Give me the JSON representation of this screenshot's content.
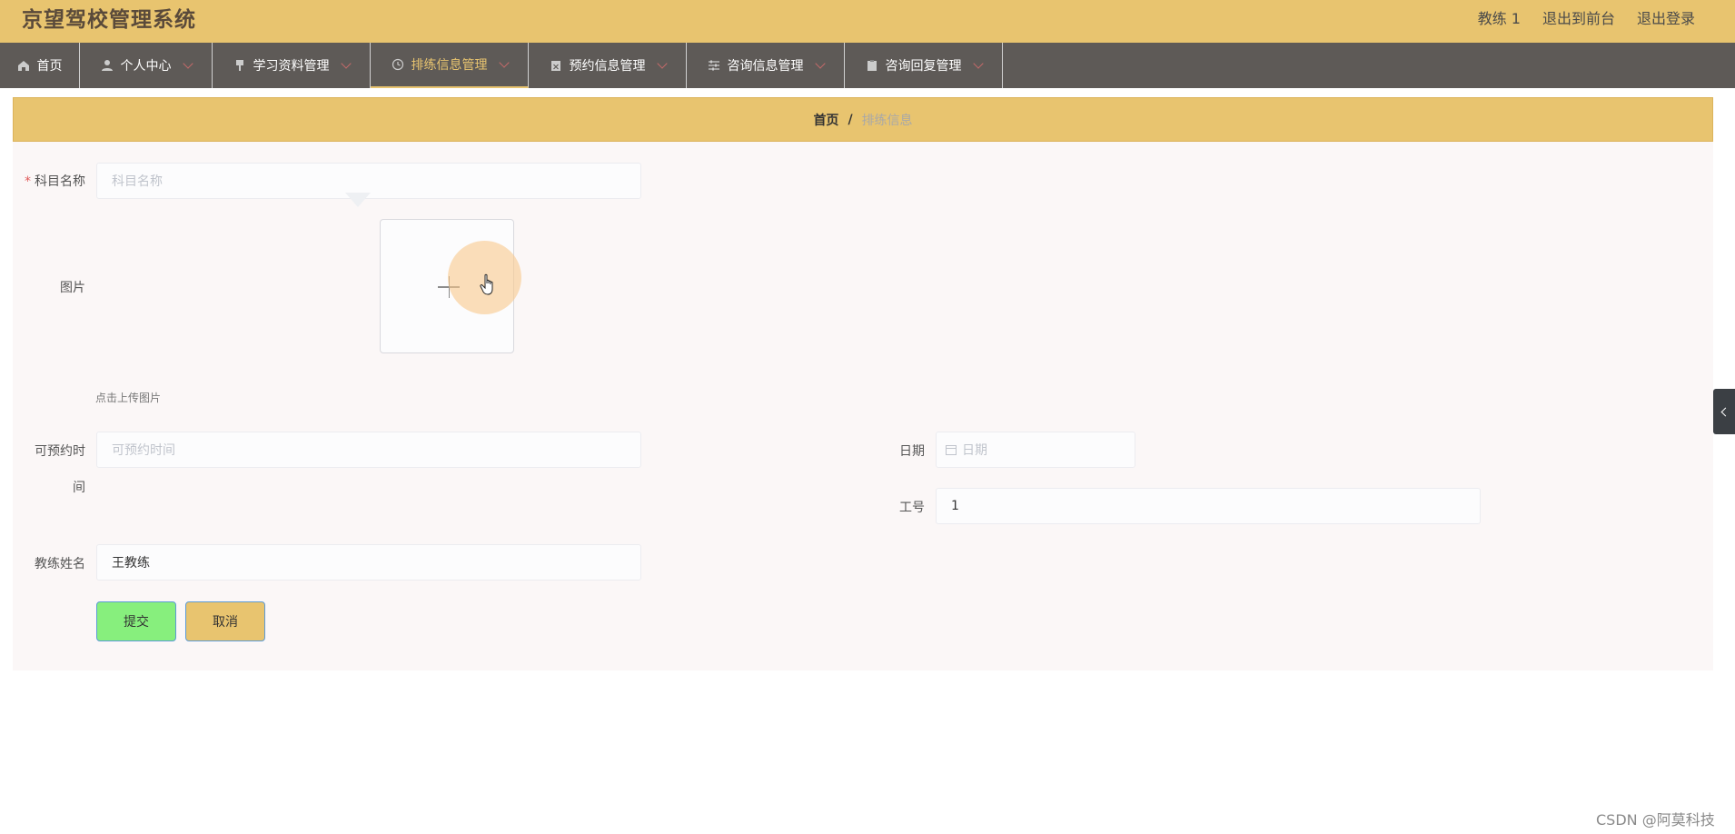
{
  "header": {
    "title": "京望驾校管理系统",
    "user": "教练 1",
    "to_front": "退出到前台",
    "logout": "退出登录"
  },
  "nav": {
    "items": [
      {
        "label": "首页",
        "icon": "home-icon"
      },
      {
        "label": "个人中心",
        "icon": "user-icon"
      },
      {
        "label": "学习资料管理",
        "icon": "pin-icon"
      },
      {
        "label": "排练信息管理",
        "icon": "clock-icon"
      },
      {
        "label": "预约信息管理",
        "icon": "calendar-x-icon"
      },
      {
        "label": "咨询信息管理",
        "icon": "sliders-icon"
      },
      {
        "label": "咨询回复管理",
        "icon": "clipboard-icon"
      }
    ],
    "active_index": 3
  },
  "breadcrumb": {
    "home": "首页",
    "separator": "/",
    "current": "排练信息"
  },
  "form": {
    "subject": {
      "label": "科目名称",
      "placeholder": "科目名称",
      "value": ""
    },
    "image": {
      "label": "图片",
      "hint": "点击上传图片"
    },
    "available_time": {
      "label_line1": "可预约时",
      "label_line2": "间",
      "placeholder": "可预约时间",
      "value": ""
    },
    "date": {
      "label": "日期",
      "placeholder": "日期",
      "value": ""
    },
    "job_no": {
      "label": "工号",
      "value": "1"
    },
    "coach_name": {
      "label": "教练姓名",
      "value": "王教练"
    },
    "submit_label": "提交",
    "cancel_label": "取消"
  },
  "colors": {
    "header_bg": "#e8c46f",
    "nav_bg": "#5e5a57",
    "submit_bg": "#87ef7d",
    "cancel_bg": "#e8c46f"
  },
  "watermark": "CSDN @阿莫科技"
}
